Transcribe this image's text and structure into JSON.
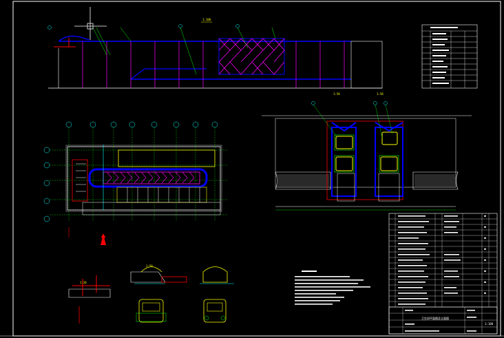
{
  "drawing": {
    "scale_left": "1:100",
    "scale_right": "1:50",
    "scale_bottom": "1:50",
    "scale_bottom2": "1:20",
    "title_row": "卫生间平面图及立面图",
    "sheet_scale": "1:100"
  },
  "colors": {
    "background": "#000000",
    "frame": "#ffffff",
    "blue": "#0000ff",
    "magenta": "#ff00ff",
    "cyan": "#00ffff",
    "yellow": "#ffff00",
    "green": "#00ff00",
    "red": "#ff0000"
  },
  "icons": {
    "crosshair": "crosshair-icon",
    "north_arrow": "north-arrow-icon"
  }
}
